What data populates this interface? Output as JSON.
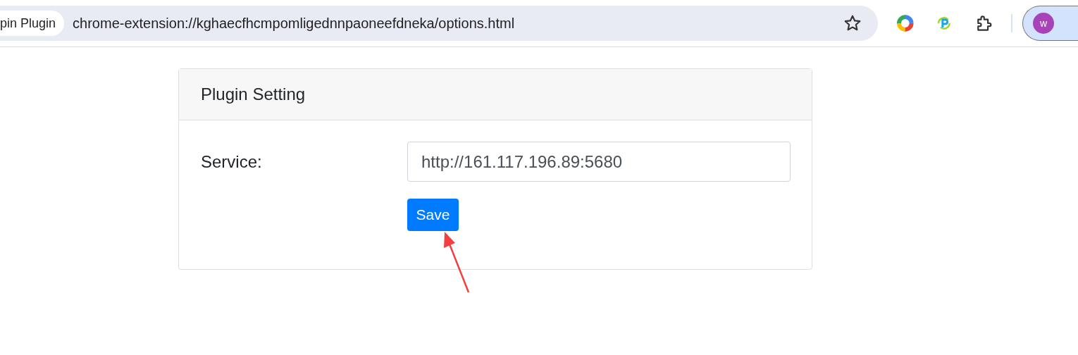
{
  "browser": {
    "tab_chip": "pin Plugin",
    "url": "chrome-extension://kghaecfhcmpomligednnpaoneefdneka/options.html",
    "profile_initial": "w"
  },
  "card": {
    "title": "Plugin Setting",
    "service_label": "Service:",
    "service_value": "http://161.117.196.89:5680",
    "save_button": "Save"
  }
}
